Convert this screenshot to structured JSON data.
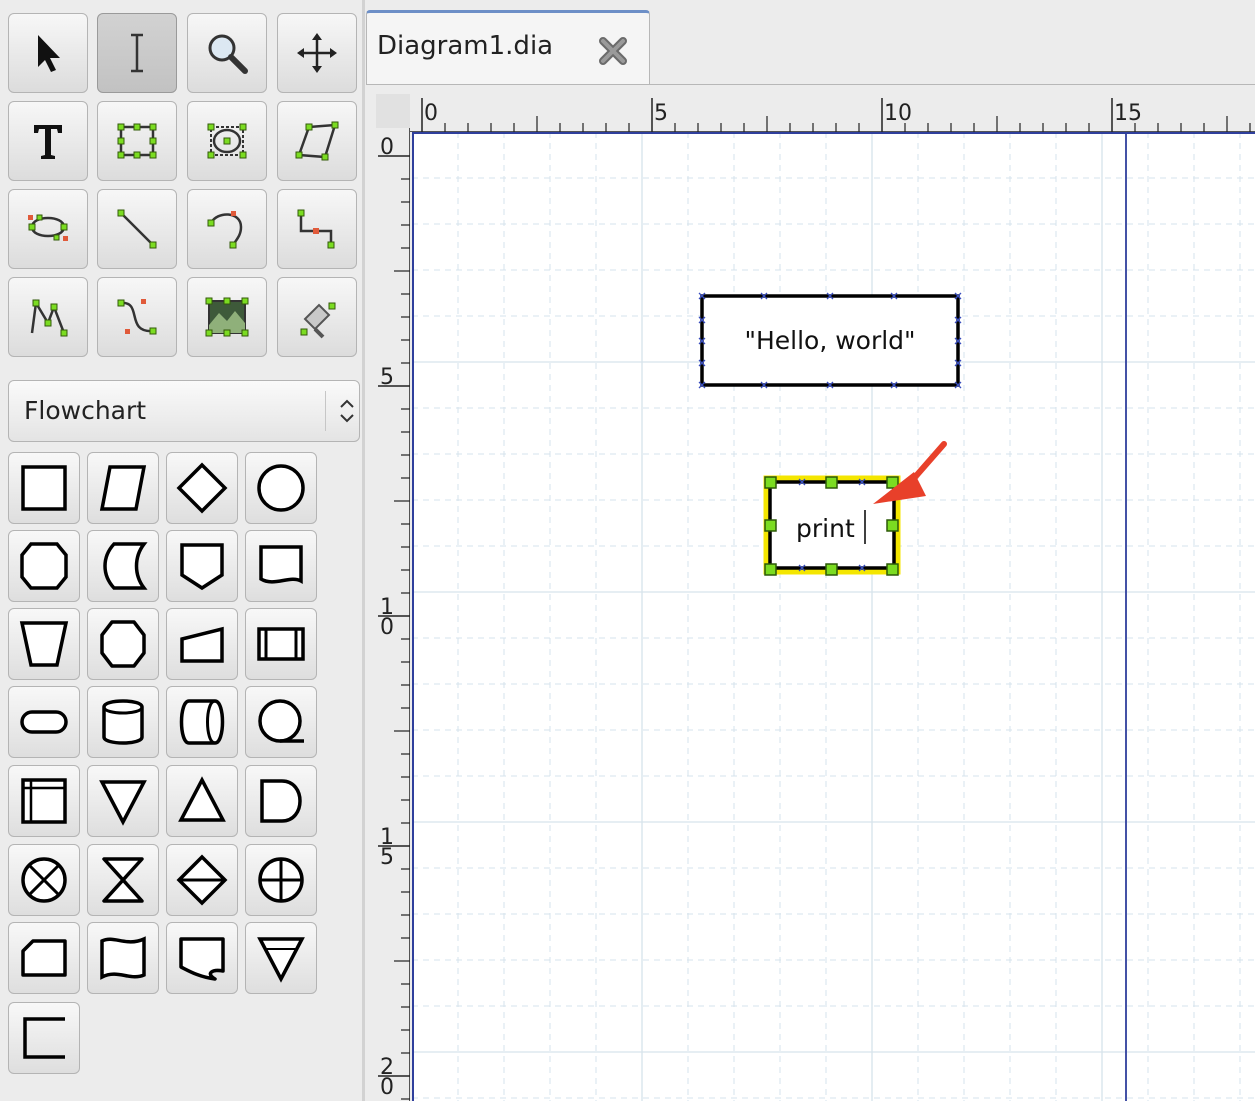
{
  "toolbox": {
    "tools": [
      {
        "name": "modify-tool",
        "icon": "arrow-pointer-icon",
        "active": false
      },
      {
        "name": "text-edit-tool",
        "icon": "text-cursor-icon",
        "active": true
      },
      {
        "name": "magnify-tool",
        "icon": "magnifier-icon",
        "active": false
      },
      {
        "name": "scroll-tool",
        "icon": "move-arrows-icon",
        "active": false
      },
      {
        "name": "text-tool",
        "icon": "text-T-icon",
        "active": false
      },
      {
        "name": "box-tool",
        "icon": "box-icon",
        "active": false
      },
      {
        "name": "ellipse-tool",
        "icon": "ellipse-icon",
        "active": false
      },
      {
        "name": "polygon-tool",
        "icon": "polygon-icon",
        "active": false
      },
      {
        "name": "beziergon-tool",
        "icon": "beziergon-icon",
        "active": false
      },
      {
        "name": "line-tool",
        "icon": "line-icon",
        "active": false
      },
      {
        "name": "arc-tool",
        "icon": "arc-icon",
        "active": false
      },
      {
        "name": "zigzag-line-tool",
        "icon": "zigzag-line-icon",
        "active": false
      },
      {
        "name": "polyline-tool",
        "icon": "polyline-icon",
        "active": false
      },
      {
        "name": "bezier-line-tool",
        "icon": "bezier-line-icon",
        "active": false
      },
      {
        "name": "image-tool",
        "icon": "image-icon",
        "active": false
      },
      {
        "name": "outline-tool",
        "icon": "outline-icon",
        "active": false
      }
    ],
    "sheet": {
      "selected": "Flowchart"
    },
    "shapes": [
      "box",
      "parallelogram",
      "diamond",
      "ellipse",
      "preparation",
      "stored-data",
      "offpage-connector",
      "document",
      "manual-operation",
      "terminal-hexagon",
      "manual-input",
      "predefined-process",
      "terminal",
      "magnetic-disk",
      "direct-access-storage",
      "sequential-data",
      "internal-storage",
      "merge",
      "extract",
      "delay",
      "summing-junction",
      "collate",
      "sort",
      "or",
      "card",
      "punched-tape",
      "multi-document",
      "offline-storage",
      "annotation"
    ]
  },
  "tab": {
    "title": "Diagram1.dia",
    "close_icon": "close-x-icon"
  },
  "rulers": {
    "horizontal": [
      "0",
      "5",
      "10",
      "15"
    ],
    "vertical": [
      "0",
      "5",
      "10",
      "15",
      "20"
    ]
  },
  "canvas": {
    "objects": [
      {
        "name": "hello-world-box",
        "text": "\"Hello, world\""
      },
      {
        "name": "print-box",
        "text": "print",
        "selected": true
      }
    ],
    "arrow_color": "#e8402a",
    "selection_color": "#f4e600",
    "handle_color": "#7bdc21",
    "grid_major_color": "#d6e3ec",
    "page_break_color": "#2f3f9c"
  }
}
